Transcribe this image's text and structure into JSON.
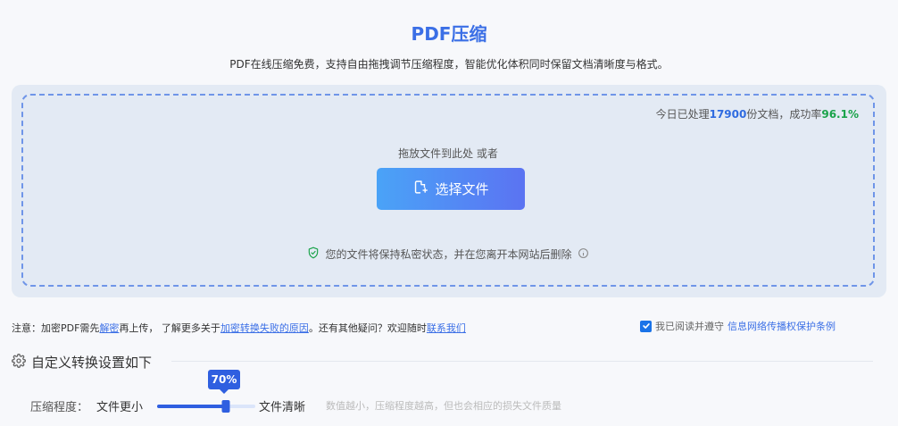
{
  "header": {
    "title": "PDF压缩",
    "subtitle": "PDF在线压缩免费，支持自由拖拽调节压缩程度，智能优化体积同时保留文档清晰度与格式。"
  },
  "dropzone": {
    "stats_prefix": "今日已处理",
    "stats_count": "17900",
    "stats_mid": "份文档，成功率",
    "stats_rate": "96.1%",
    "hint": "拖放文件到此处 或者",
    "select_button": "选择文件",
    "privacy_text": "您的文件将保持私密状态，并在您离开本网站后删除"
  },
  "notice": {
    "prefix": "注意：加密PDF需先",
    "decrypt_link": "解密",
    "mid1": "再上传，  了解更多关于",
    "fail_link": "加密转换失败的原因",
    "mid2": "。还有其他疑问？欢迎随时",
    "contact_link": "联系我们"
  },
  "agreement": {
    "prefix": "我已阅读并遵守",
    "link": "信息网络传播权保护条例",
    "checked": true
  },
  "settings": {
    "heading": "自定义转换设置如下",
    "compress_label": "压缩程度：",
    "small_label": "文件更小",
    "clear_label": "文件清晰",
    "hint": "数值越小，压缩程度越高，但也会相应的损失文件质量",
    "level_text": "70%",
    "level": 0.7
  },
  "colors": {
    "accent": "#3b6fe6",
    "success": "#1aa34a"
  },
  "icons": [
    "file-upload-icon",
    "shield-check-icon",
    "info-icon",
    "checkbox-check-icon",
    "gear-icon"
  ]
}
